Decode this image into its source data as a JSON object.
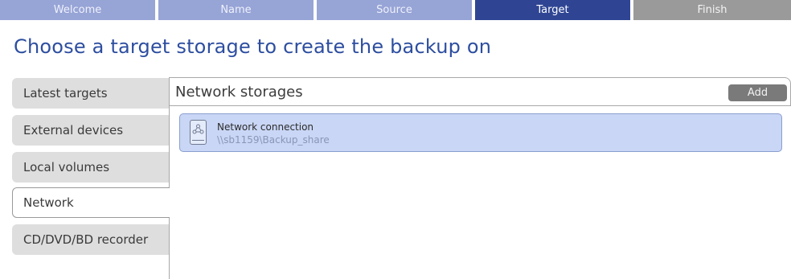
{
  "wizard": {
    "steps": [
      {
        "label": "Welcome",
        "state": "done"
      },
      {
        "label": "Name",
        "state": "done"
      },
      {
        "label": "Source",
        "state": "done"
      },
      {
        "label": "Target",
        "state": "active"
      },
      {
        "label": "Finish",
        "state": "todo"
      }
    ]
  },
  "page": {
    "title": "Choose a target storage to create the backup on"
  },
  "categories": [
    {
      "label": "Latest targets"
    },
    {
      "label": "External devices"
    },
    {
      "label": "Local volumes"
    },
    {
      "label": "Network",
      "selected": true
    },
    {
      "label": "CD/DVD/BD recorder"
    }
  ],
  "panel": {
    "title": "Network storages",
    "add_label": "Add",
    "items": [
      {
        "name": "Network connection",
        "path": "\\\\sb1159\\Backup_share",
        "icon": "network-drive-icon"
      }
    ]
  },
  "colors": {
    "step_done": "#97a4d6",
    "step_active": "#2f4594",
    "step_todo": "#9a9a9a",
    "title": "#2d4ea0",
    "item_selected_bg": "#c9d6f5"
  }
}
